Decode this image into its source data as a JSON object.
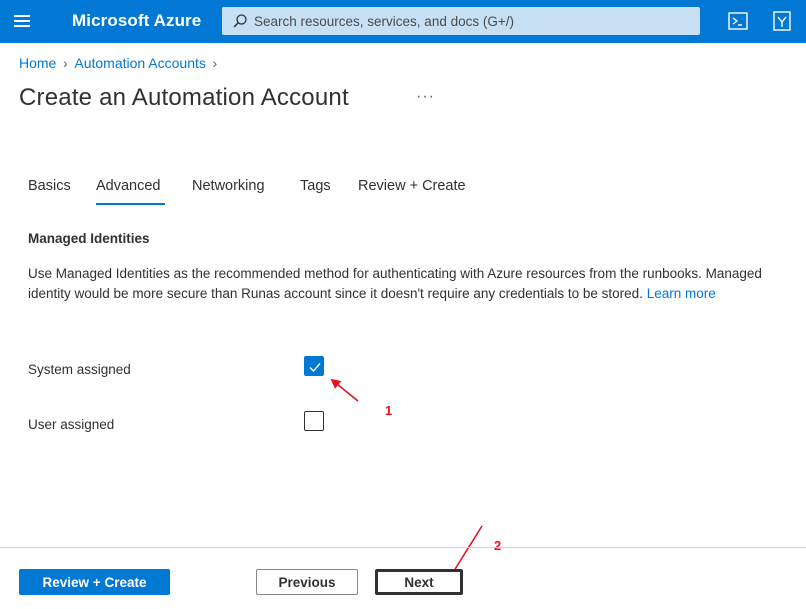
{
  "topbar": {
    "brand": "Microsoft Azure",
    "search_placeholder": "Search resources, services, and docs (G+/)",
    "icons": [
      "hamburger-menu-icon",
      "search-icon",
      "cloud-shell-icon",
      "directory-filter-icon"
    ],
    "colors": {
      "bar": "#0078d4",
      "search_bg": "#c7e0f4"
    }
  },
  "breadcrumb": {
    "items": [
      "Home",
      "Automation Accounts"
    ]
  },
  "page": {
    "title": "Create an Automation Account",
    "more": "···"
  },
  "tabs": [
    {
      "label": "Basics",
      "active": false
    },
    {
      "label": "Advanced",
      "active": true
    },
    {
      "label": "Networking",
      "active": false
    },
    {
      "label": "Tags",
      "active": false
    },
    {
      "label": "Review + Create",
      "active": false
    }
  ],
  "managed_identities": {
    "title": "Managed Identities",
    "description": "Use Managed Identities as the recommended method for authenticating with Azure resources from the runbooks. Managed identity would be more secure than Runas account since it doesn't require any credentials to be stored.",
    "learn_more": "Learn more",
    "system_assigned": {
      "label": "System assigned",
      "checked": true
    },
    "user_assigned": {
      "label": "User assigned",
      "checked": false
    }
  },
  "annotations": {
    "step1": "1",
    "step2": "2",
    "color": "#e81123"
  },
  "footer": {
    "review_create": "Review + Create",
    "previous": "Previous",
    "next": "Next"
  }
}
